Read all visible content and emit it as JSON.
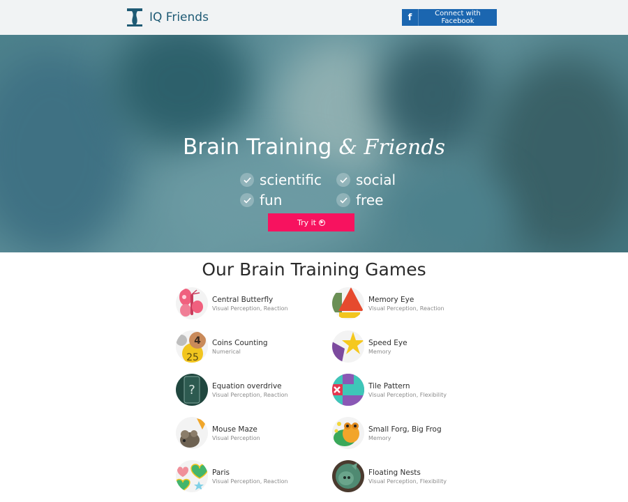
{
  "header": {
    "brand": "IQ Friends",
    "facebook_label": "Connect with Facebook",
    "facebook_glyph": "f",
    "brand_color": "#1e5a74",
    "facebook_color": "#1b66b0"
  },
  "hero": {
    "title_main": "Brain Training",
    "title_amp": "& Friends",
    "features": [
      "scientific",
      "social",
      "fun",
      "free"
    ],
    "cta_label": "Try it",
    "cta_color": "#f7125f"
  },
  "games": {
    "title": "Our Brain Training Games",
    "items": [
      {
        "name": "Central Butterfly",
        "tags": "Visual Perception, Reaction",
        "icon": "butterfly-icon"
      },
      {
        "name": "Memory Eye",
        "tags": "Visual Perception, Reaction",
        "icon": "memory-eye-icon"
      },
      {
        "name": "Coins Counting",
        "tags": "Numerical",
        "icon": "coins-icon"
      },
      {
        "name": "Speed Eye",
        "tags": "Memory",
        "icon": "star-icon"
      },
      {
        "name": "Equation overdrive",
        "tags": "Visual Perception, Reaction",
        "icon": "equation-icon"
      },
      {
        "name": "Tile Pattern",
        "tags": "Visual Perception, Flexibility",
        "icon": "tile-pattern-icon"
      },
      {
        "name": "Mouse Maze",
        "tags": "Visual Perception",
        "icon": "mouse-icon"
      },
      {
        "name": "Small Forg, Big Frog",
        "tags": "Memory",
        "icon": "frog-icon"
      },
      {
        "name": "Paris",
        "tags": "Visual Perception, Reaction",
        "icon": "hearts-icon"
      },
      {
        "name": "Floating Nests",
        "tags": "Visual Perception, Flexibility",
        "icon": "nest-icon"
      }
    ],
    "coin_numbers": [
      "4",
      "25"
    ],
    "equation_glyph": "?"
  }
}
